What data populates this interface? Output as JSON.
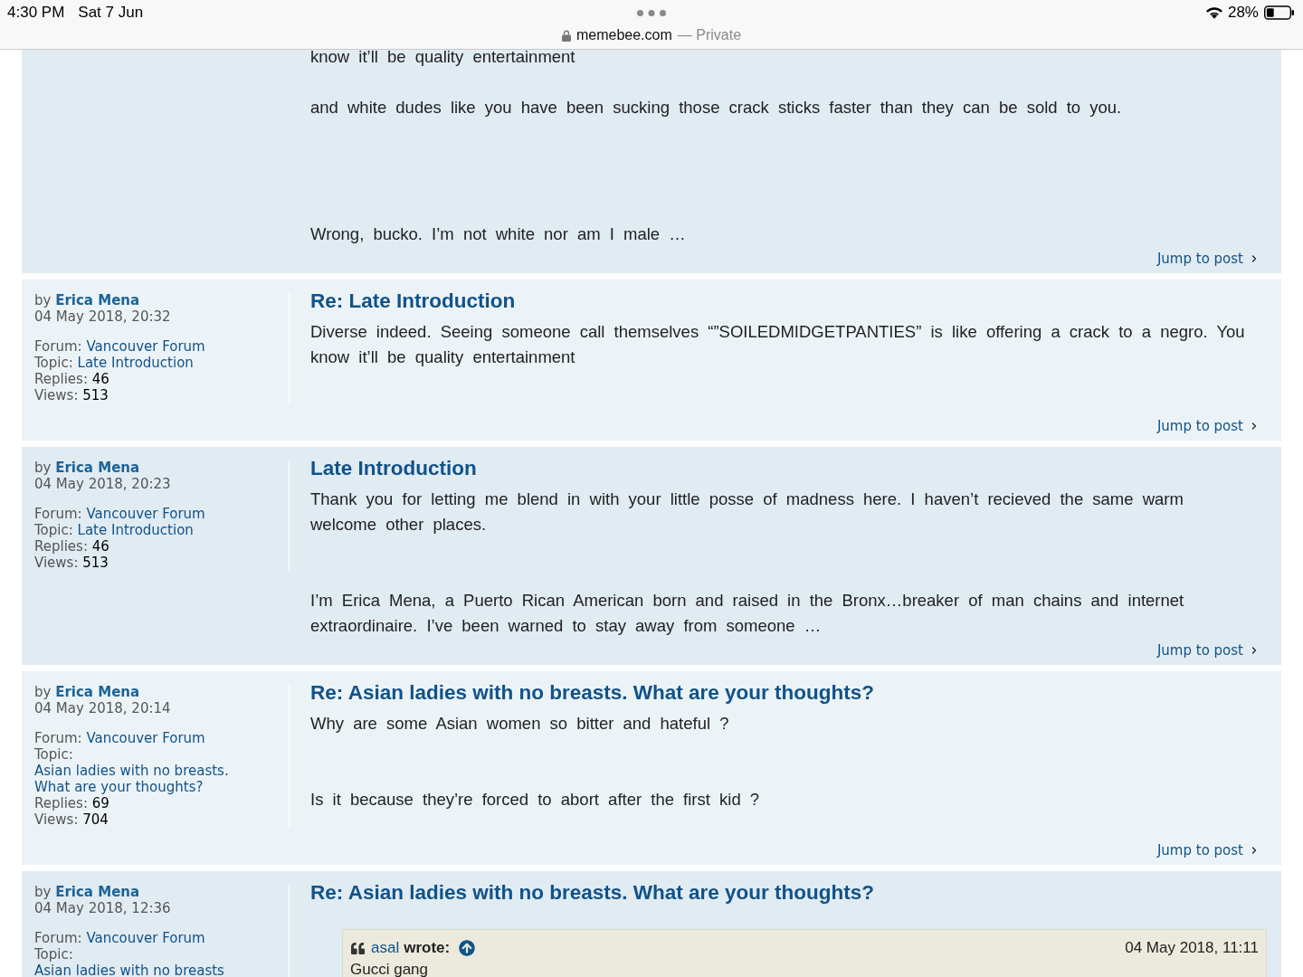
{
  "status_bar": {
    "time": "4:30 PM",
    "date": "Sat 7 Jun",
    "battery": "28%"
  },
  "address_bar": {
    "domain": "memebee.com",
    "mode": "— Private"
  },
  "results": [
    {
      "body": "know it’ll be quality entertainment\n\nand white dudes like you have been sucking those crack sticks faster than they can be sold to you.\n\n\n\n\nWrong, bucko. I’m not white nor am I male …",
      "jump_link": "Jump to post"
    },
    {
      "author_prefix": "by",
      "author": "Erica Mena",
      "date": "04 May 2018, 20:32",
      "forum_label": "Forum:",
      "forum": "Vancouver Forum",
      "topic_label": "Topic:",
      "topic": "Late Introduction",
      "replies_label": "Replies:",
      "replies": "46",
      "views_label": "Views:",
      "views": "513",
      "title": "Re: Late Introduction",
      "body": "Diverse indeed. Seeing someone call themselves “”SOILEDMIDGETPANTIES” is like offering a crack to a negro. You know it’ll be quality entertainment",
      "jump_link": "Jump to post"
    },
    {
      "author_prefix": "by",
      "author": "Erica Mena",
      "date": "04 May 2018, 20:23",
      "forum_label": "Forum:",
      "forum": "Vancouver Forum",
      "topic_label": "Topic:",
      "topic": "Late Introduction",
      "replies_label": "Replies:",
      "replies": "46",
      "views_label": "Views:",
      "views": "513",
      "title": "Late Introduction",
      "body": "Thank you for letting me blend in with your little posse of madness here. I haven’t recieved the same warm welcome other places.\n\n\nI’m Erica Mena, a Puerto Rican American born and raised in the Bronx…breaker of man chains and internet extraordinaire. I’ve been warned to stay away from someone …",
      "jump_link": "Jump to post"
    },
    {
      "author_prefix": "by",
      "author": "Erica Mena",
      "date": "04 May 2018, 20:14",
      "forum_label": "Forum:",
      "forum": "Vancouver Forum",
      "topic_label": "Topic:",
      "topic": "Asian ladies with no breasts. What are your thoughts?",
      "replies_label": "Replies:",
      "replies": "69",
      "views_label": "Views:",
      "views": "704",
      "title": "Re: Asian ladies with no breasts. What are your thoughts?",
      "body": "Why are some Asian women so bitter and hateful ?\n\n\nIs it because they’re forced to abort after the first kid ?",
      "jump_link": "Jump to post"
    },
    {
      "author_prefix": "by",
      "author": "Erica Mena",
      "date": "04 May 2018, 12:36",
      "forum_label": "Forum:",
      "forum": "Vancouver Forum",
      "topic_label": "Topic:",
      "topic": "Asian ladies with no breasts",
      "title": "Re: Asian ladies with no breasts. What are your thoughts?",
      "quote": {
        "author": "asal",
        "verb": "wrote:",
        "date": "04 May 2018, 11:11",
        "text": "Gucci gang"
      }
    }
  ]
}
